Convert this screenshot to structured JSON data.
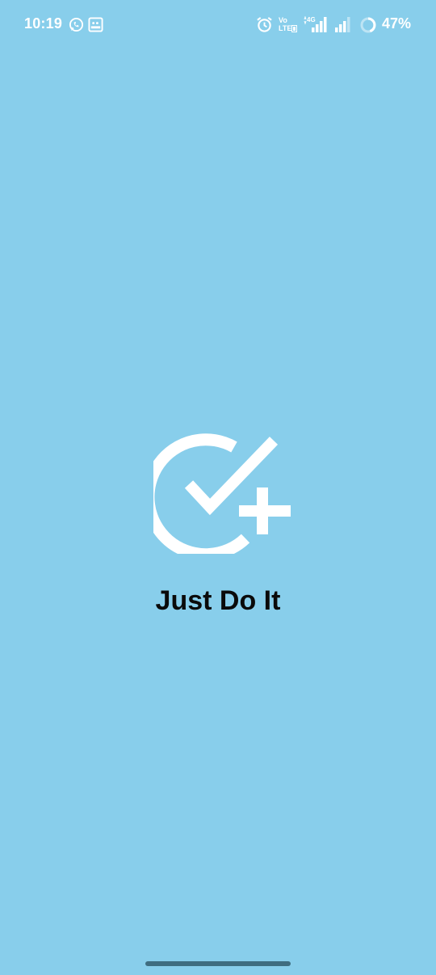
{
  "status_bar": {
    "time": "10:19",
    "network_volte": "Vo",
    "network_lte": "LTE",
    "network_type": "4G",
    "battery_percent": "47%",
    "icons": [
      "whatsapp-icon",
      "gallery-notification-icon",
      "alarm-icon",
      "signal-icon",
      "signal-icon",
      "battery-ring-icon"
    ]
  },
  "splash": {
    "app_name": "Just Do It",
    "logo_icon": "check-circle-plus-icon"
  },
  "colors": {
    "background": "#88ceeb",
    "logo": "#ffffff",
    "title": "#0a0a0a",
    "home_indicator": "#3f6d80"
  }
}
